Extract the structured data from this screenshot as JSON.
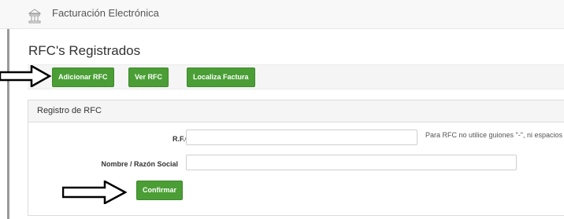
{
  "app": {
    "title": "Facturación Electrónica",
    "logo_icon": "building-icon"
  },
  "page": {
    "title": "RFC's Registrados"
  },
  "toolbar": {
    "buttons": [
      {
        "label": "Adicionar RFC"
      },
      {
        "label": "Ver RFC"
      },
      {
        "label": "Localiza Factura"
      }
    ]
  },
  "panel": {
    "title": "Registro de RFC",
    "rfc_label": "R.F.C.",
    "rfc_value": "",
    "rfc_hint": "Para RFC no utilice guiones \"-\", ni espacios",
    "name_label": "Nombre / Razón Social",
    "name_value": "",
    "confirm_label": "Confirmar"
  },
  "annotations": {
    "arrow_icon": "right-arrow-icon"
  },
  "colors": {
    "button_green": "#4a9e35",
    "topbar_bg": "#f8f8f8"
  }
}
